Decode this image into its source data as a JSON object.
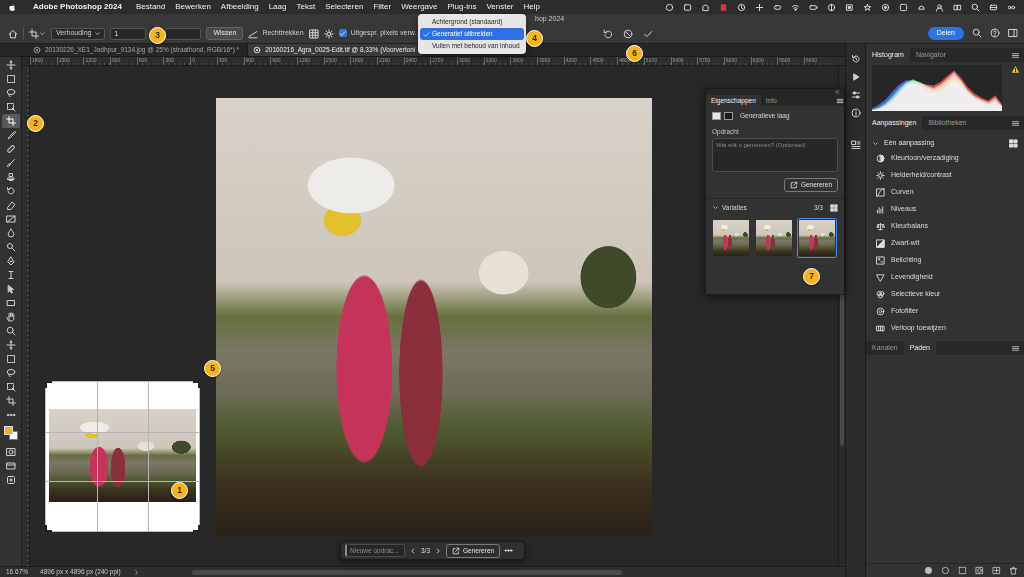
{
  "menubar": {
    "app": "Adobe Photoshop 2024",
    "items": [
      "Bestand",
      "Bewerken",
      "Afbeelding",
      "Laag",
      "Tekst",
      "Selecteren",
      "Filter",
      "Weergave",
      "Plug-ins",
      "Venster",
      "Help"
    ]
  },
  "window": {
    "title": "hop 2024"
  },
  "fill_menu": {
    "items": [
      {
        "label": "Achtergrond (standaard)",
        "selected": false
      },
      {
        "label": "Generatief uitbreiden",
        "selected": true
      },
      {
        "label": "Vullen met behoud van inhoud",
        "selected": false
      }
    ]
  },
  "options_bar": {
    "ratio": "Verhouding",
    "ratio_value": "1",
    "clear": "Wissen",
    "straighten": "Rechttrekken",
    "delete_pixels": {
      "label": "Uitgespr. pixels verw.",
      "checked": true
    },
    "fill_label": "Ve",
    "share": "Delen"
  },
  "doc_tabs": [
    {
      "label": "20130226_XE1_Jodhpur_9134.jpg @ 25% (straathond, RGB/16*) *",
      "selected": false
    },
    {
      "label": "20160216_Agra_0025-Edit.tif @ 8,33% (Voorvertoni",
      "selected": true
    }
  ],
  "ruler": {
    "labels": [
      "1800",
      "1500",
      "1200",
      "900",
      "600",
      "300",
      "0",
      "300",
      "600",
      "900",
      "1200",
      "1500",
      "1800",
      "2100",
      "2400",
      "2700",
      "3000",
      "3300",
      "3600",
      "3900",
      "4200",
      "4500",
      "4800",
      "5100",
      "5400",
      "5700",
      "6000",
      "6300",
      "6600",
      "6900"
    ]
  },
  "toolbar": {
    "tools": [
      {
        "selected": false
      },
      {
        "selected": false
      },
      {
        "selected": false
      },
      {
        "selected": false
      },
      {
        "selected": true
      },
      {
        "selected": false
      },
      {
        "selected": false
      },
      {
        "selected": false
      },
      {
        "selected": false
      },
      {
        "selected": false
      },
      {
        "selected": false
      },
      {
        "selected": false
      },
      {
        "selected": false
      },
      {
        "selected": false
      },
      {
        "selected": false
      },
      {
        "selected": false
      },
      {
        "selected": false
      },
      {
        "selected": false
      },
      {
        "selected": false
      },
      {
        "selected": false
      },
      {
        "selected": false
      },
      {
        "selected": false
      },
      {
        "selected": false
      },
      {
        "selected": false
      },
      {
        "selected": false
      }
    ]
  },
  "properties": {
    "tabs": [
      {
        "label": "Eigenschappen",
        "selected": true
      },
      {
        "label": "Info",
        "selected": false
      }
    ],
    "layer": "Generatieve laag",
    "prompt_label": "Opdracht",
    "prompt_placeholder": "Wat wilt u genereren? (Optioneel)",
    "generate": "Genereren",
    "variations": {
      "title": "Variaties",
      "expanded": true,
      "count": "3/3",
      "items": [
        {
          "selected": false
        },
        {
          "selected": false
        },
        {
          "selected": true
        }
      ]
    }
  },
  "context_bar": {
    "placeholder": "Nieuwe opdrac...",
    "count": "3/3",
    "generate": "Genereren"
  },
  "histogram_panel": {
    "tabs": [
      {
        "label": "Histogram",
        "selected": true
      },
      {
        "label": "Navigator",
        "selected": false
      }
    ],
    "series": [
      {
        "color": "#c8c8c8",
        "values": [
          2,
          6,
          14,
          28,
          46,
          62,
          70,
          66,
          58,
          52,
          60,
          74,
          88,
          70,
          48,
          34,
          26,
          20,
          30,
          12
        ]
      },
      {
        "color": "#ff4040",
        "values": [
          1,
          4,
          10,
          22,
          40,
          58,
          64,
          62,
          60,
          58,
          66,
          80,
          92,
          76,
          54,
          40,
          30,
          24,
          36,
          16
        ]
      },
      {
        "color": "#40e040",
        "values": [
          3,
          8,
          18,
          34,
          52,
          66,
          72,
          64,
          54,
          48,
          54,
          66,
          80,
          66,
          44,
          30,
          22,
          16,
          24,
          10
        ]
      },
      {
        "color": "#4060ff",
        "values": [
          6,
          14,
          26,
          44,
          60,
          70,
          68,
          58,
          48,
          42,
          46,
          56,
          70,
          58,
          40,
          28,
          20,
          14,
          20,
          8
        ]
      }
    ]
  },
  "adjustments_panel": {
    "tabs": [
      {
        "label": "Aanpassingen",
        "selected": true
      },
      {
        "label": "Bibliotheken",
        "selected": false
      }
    ],
    "group": {
      "label": "Eén aanpassing",
      "expanded": true
    },
    "items": [
      "Kleurtoon/verzadiging",
      "Helderheid/contrast",
      "Curven",
      "Niveaus",
      "Kleurbalans",
      "Zwart-wit",
      "Belichting",
      "Levendigheid",
      "Selectieve kleur",
      "Fotofilter",
      "Verloop toewijzen"
    ]
  },
  "bottom_panel": {
    "tabs": [
      {
        "label": "Kanalen",
        "selected": false
      },
      {
        "label": "Paden",
        "selected": true
      }
    ]
  },
  "status_bar": {
    "zoom": "16.67%",
    "size": "4896 px x 4896 px (240 ppi)"
  },
  "annotations": [
    {
      "label": "1"
    },
    {
      "label": "2"
    },
    {
      "label": "3"
    },
    {
      "label": "4"
    },
    {
      "label": "5"
    },
    {
      "label": "6"
    },
    {
      "label": "7"
    }
  ]
}
